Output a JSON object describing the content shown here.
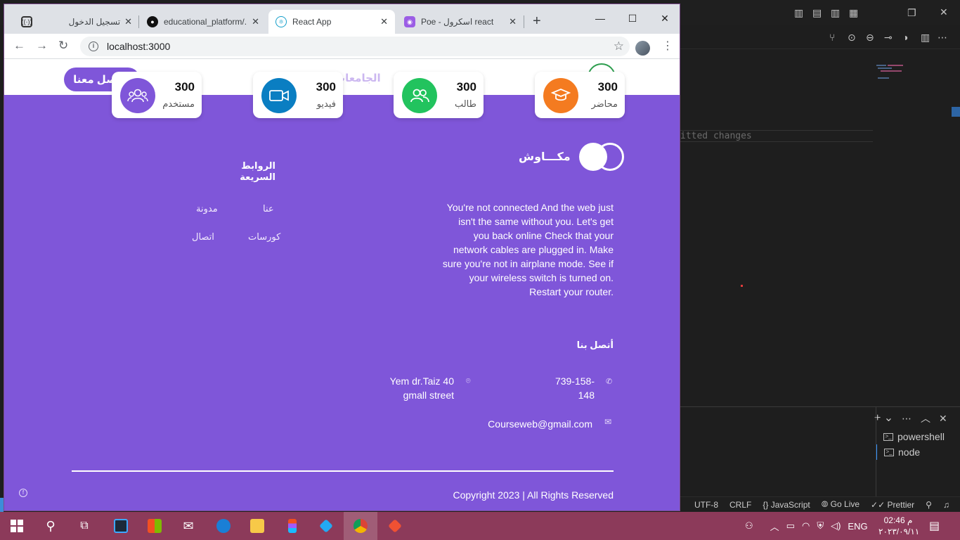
{
  "browser": {
    "tabs": [
      {
        "title": "تسجيل الدخول",
        "favicon": "broadcast-icon",
        "active": false
      },
      {
        "title": "educational_platform/...",
        "favicon": "github-icon",
        "active": false
      },
      {
        "title": "React App",
        "favicon": "react-icon",
        "active": true
      },
      {
        "title": "Poe - اسكرول react",
        "favicon": "poe-icon",
        "active": false
      }
    ],
    "url": "localhost:3000"
  },
  "site": {
    "header": {
      "nav_faded": "الجامعات",
      "contact_button": "تواصل معنا"
    },
    "stats": [
      {
        "value": "300",
        "label": "محاضر",
        "icon": "graduation-cap-icon",
        "color": "#f47b20"
      },
      {
        "value": "300",
        "label": "طالب",
        "icon": "users-icon",
        "color": "#22c35e"
      },
      {
        "value": "300",
        "label": "فيديو",
        "icon": "video-icon",
        "color": "#0a7ec2"
      },
      {
        "value": "300",
        "label": "مستخدم",
        "icon": "user-group-icon",
        "color": "#7f56d9"
      }
    ],
    "brand_name": "مكـــاوش",
    "about": "You're not connected And the web just isn't the same without you. Let's get you back online Check that your network cables are plugged in. Make sure you're not in airplane mode. See if your wireless switch is turned on. Restart your router.",
    "quick_links": {
      "title": "الروابط السريعة",
      "items": [
        "عنا",
        "مدونة",
        "كورسات",
        "اتصال"
      ]
    },
    "contact": {
      "title": "أتصل بنا",
      "phone": "739-158-148",
      "address": "Yem dr.Taiz 40 gmall street",
      "email": "Courseweb@gmail.com"
    },
    "copyright": "Copyright 2023 | All Rights Reserved"
  },
  "vscode": {
    "message_fragment": "itted changes",
    "terminals": [
      "powershell",
      "node"
    ],
    "status": [
      "UTF-8",
      "CRLF",
      "JavaScript",
      "Go Live",
      "Prettier"
    ]
  },
  "taskbar": {
    "language": "ENG",
    "time": "02:46 م",
    "date": "٢٠٢٣/٠٩/١١"
  },
  "accent": "#7f56d9"
}
